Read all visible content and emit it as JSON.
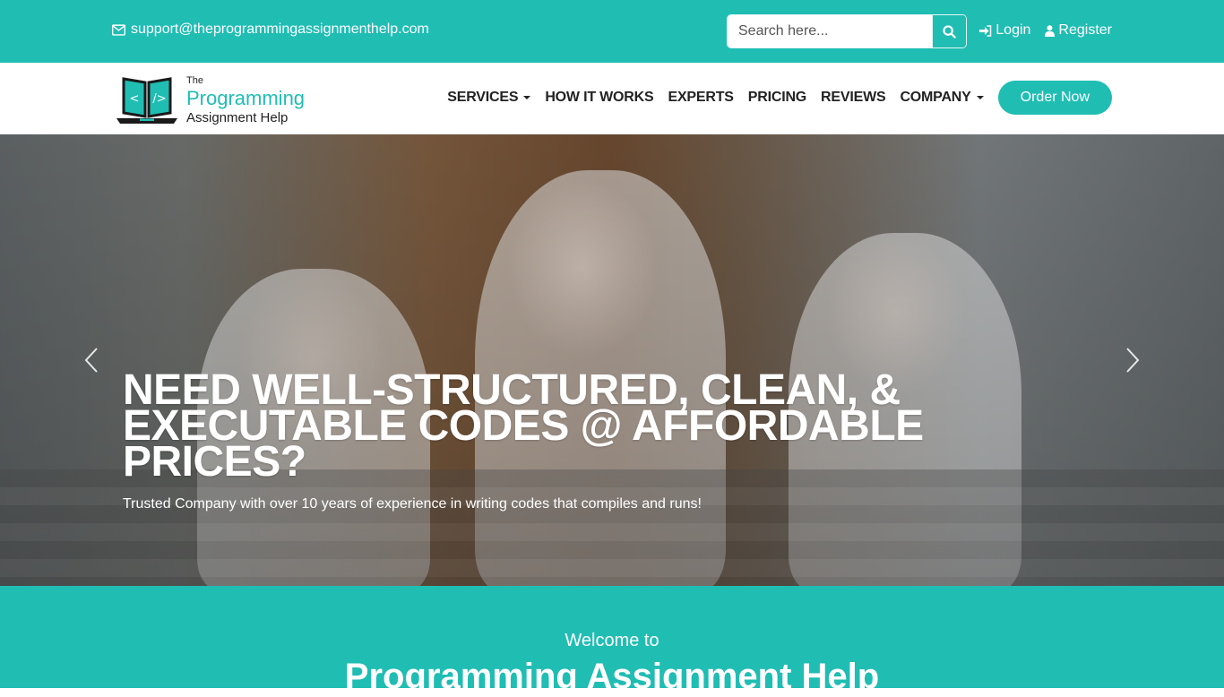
{
  "colors": {
    "brand": "#20bdb3",
    "text_dark": "#222222",
    "white": "#ffffff"
  },
  "topbar": {
    "email_icon": "envelope-icon",
    "email": "support@theprogrammingassignmenthelp.com",
    "search": {
      "placeholder": "Search here...",
      "value": "",
      "button_icon": "search-icon"
    },
    "login": {
      "icon": "sign-in-icon",
      "label": "Login"
    },
    "register": {
      "icon": "user-icon",
      "label": "Register"
    }
  },
  "navbar": {
    "logo": {
      "line1": "The",
      "line2": "Programming",
      "line3": "Assignment Help",
      "icon": "laptop-code-icon"
    },
    "items": [
      {
        "label": "SERVICES",
        "dropdown": true
      },
      {
        "label": "HOW IT WORKS",
        "dropdown": false
      },
      {
        "label": "EXPERTS",
        "dropdown": false
      },
      {
        "label": "PRICING",
        "dropdown": false
      },
      {
        "label": "REVIEWS",
        "dropdown": false
      },
      {
        "label": "COMPANY",
        "dropdown": true
      }
    ],
    "order_button": "Order Now"
  },
  "hero": {
    "title": "Need well-structured, clean, & executable codes @ affordable prices?",
    "subtitle": "Trusted Company with over 10 years of experience in writing codes that compiles and runs!",
    "prev_icon": "chevron-left-icon",
    "next_icon": "chevron-right-icon"
  },
  "welcome": {
    "pre": "Welcome to",
    "title": "Programming Assignment Help"
  }
}
